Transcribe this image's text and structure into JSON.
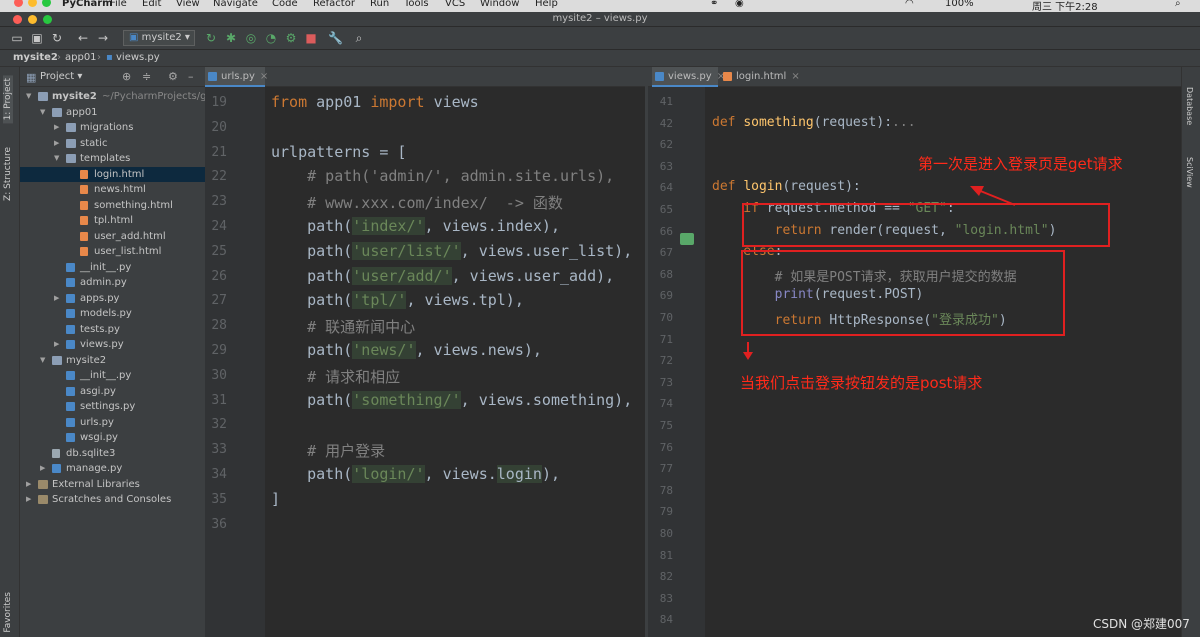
{
  "menubar": {
    "app": "PyCharm",
    "items": [
      "File",
      "Edit",
      "View",
      "Navigate",
      "Code",
      "Refactor",
      "Run",
      "Tools",
      "VCS",
      "Window",
      "Help"
    ],
    "title": "mysite2 – views.py",
    "battery": "100%",
    "clock": "周三 下午2:28"
  },
  "toolbar": {
    "run_config": "mysite2"
  },
  "breadcrumb": {
    "items": [
      "mysite2",
      "app01",
      "views.py"
    ]
  },
  "left_toolwindows": [
    "1: Project",
    "Z: Structure",
    "Favorites"
  ],
  "right_toolwindows": [
    "Database",
    "SciView"
  ],
  "project": {
    "title": "Project",
    "tree": [
      {
        "label": "mysite2",
        "suffix": "~/PycharmProjects/gx",
        "depth": 0,
        "type": "folder",
        "expanded": true
      },
      {
        "label": "app01",
        "depth": 1,
        "type": "folder",
        "expanded": true
      },
      {
        "label": "migrations",
        "depth": 2,
        "type": "folder",
        "expanded": false
      },
      {
        "label": "static",
        "depth": 2,
        "type": "folder",
        "expanded": false
      },
      {
        "label": "templates",
        "depth": 2,
        "type": "folder",
        "expanded": true
      },
      {
        "label": "login.html",
        "depth": 3,
        "type": "html",
        "selected": true
      },
      {
        "label": "news.html",
        "depth": 3,
        "type": "html"
      },
      {
        "label": "something.html",
        "depth": 3,
        "type": "html"
      },
      {
        "label": "tpl.html",
        "depth": 3,
        "type": "html"
      },
      {
        "label": "user_add.html",
        "depth": 3,
        "type": "html"
      },
      {
        "label": "user_list.html",
        "depth": 3,
        "type": "html"
      },
      {
        "label": "__init__.py",
        "depth": 2,
        "type": "py"
      },
      {
        "label": "admin.py",
        "depth": 2,
        "type": "py"
      },
      {
        "label": "apps.py",
        "depth": 2,
        "type": "py",
        "collapsible": true
      },
      {
        "label": "models.py",
        "depth": 2,
        "type": "py"
      },
      {
        "label": "tests.py",
        "depth": 2,
        "type": "py"
      },
      {
        "label": "views.py",
        "depth": 2,
        "type": "py",
        "collapsible": true
      },
      {
        "label": "mysite2",
        "depth": 1,
        "type": "folder",
        "expanded": true
      },
      {
        "label": "__init__.py",
        "depth": 2,
        "type": "py"
      },
      {
        "label": "asgi.py",
        "depth": 2,
        "type": "py"
      },
      {
        "label": "settings.py",
        "depth": 2,
        "type": "py"
      },
      {
        "label": "urls.py",
        "depth": 2,
        "type": "py"
      },
      {
        "label": "wsgi.py",
        "depth": 2,
        "type": "py"
      },
      {
        "label": "db.sqlite3",
        "depth": 1,
        "type": "db"
      },
      {
        "label": "manage.py",
        "depth": 1,
        "type": "py",
        "collapsible": true
      },
      {
        "label": "External Libraries",
        "depth": 0,
        "type": "lib",
        "expanded": false
      },
      {
        "label": "Scratches and Consoles",
        "depth": 0,
        "type": "lib",
        "expanded": false
      }
    ]
  },
  "left_editor": {
    "tabs": [
      {
        "label": "urls.py",
        "active": true
      }
    ],
    "line_numbers": [
      "19",
      "20",
      "21",
      "22",
      "23",
      "24",
      "25",
      "26",
      "27",
      "28",
      "29",
      "30",
      "31",
      "32",
      "33",
      "34",
      "35",
      "36"
    ],
    "lines": [
      [
        [
          "kw",
          "from "
        ],
        [
          "t",
          "app01 "
        ],
        [
          "kw",
          "import "
        ],
        [
          "t",
          "views"
        ]
      ],
      [],
      [
        [
          "t",
          "urlpatterns = ["
        ]
      ],
      [
        [
          "cm",
          "    # path('admin/', admin.site.urls),"
        ]
      ],
      [
        [
          "cm",
          "    # www.xxx.com/index/  -> 函数"
        ]
      ],
      [
        [
          "t",
          "    path("
        ],
        [
          "strh",
          "'index/'"
        ],
        [
          "t",
          ", views.index),"
        ]
      ],
      [
        [
          "t",
          "    path("
        ],
        [
          "strh",
          "'user/list/'"
        ],
        [
          "t",
          ", views.user_list),"
        ]
      ],
      [
        [
          "t",
          "    path("
        ],
        [
          "strh",
          "'user/add/'"
        ],
        [
          "t",
          ", views.user_add),"
        ]
      ],
      [
        [
          "t",
          "    path("
        ],
        [
          "strh",
          "'tpl/'"
        ],
        [
          "t",
          ", views.tpl),"
        ]
      ],
      [
        [
          "cm",
          "    # 联通新闻中心"
        ]
      ],
      [
        [
          "t",
          "    path("
        ],
        [
          "strh",
          "'news/'"
        ],
        [
          "t",
          ", views.news),"
        ]
      ],
      [
        [
          "cm",
          "    # 请求和相应"
        ]
      ],
      [
        [
          "t",
          "    path("
        ],
        [
          "strh",
          "'something/'"
        ],
        [
          "t",
          ", views.something),"
        ]
      ],
      [],
      [
        [
          "cm",
          "    # 用户登录"
        ]
      ],
      [
        [
          "t",
          "    path("
        ],
        [
          "strh",
          "'login/'"
        ],
        [
          "t",
          ", views."
        ],
        [
          "th",
          "login"
        ],
        [
          "t",
          "),"
        ]
      ],
      [
        [
          "t",
          "]"
        ]
      ],
      []
    ]
  },
  "right_editor": {
    "tabs": [
      {
        "label": "views.py",
        "active": true
      },
      {
        "label": "login.html",
        "active": false
      }
    ],
    "line_numbers": [
      "41",
      "42",
      "62",
      "63",
      "64",
      "65",
      "66",
      "67",
      "68",
      "69",
      "70",
      "71",
      "72",
      "73",
      "74",
      "75",
      "76",
      "77",
      "78",
      "79",
      "80",
      "81",
      "82",
      "83",
      "84"
    ],
    "lines": [
      [],
      [
        [
          "kw",
          "def "
        ],
        [
          "fn",
          "something"
        ],
        [
          "t",
          "(request):"
        ],
        [
          "cm",
          "..."
        ]
      ],
      [],
      [],
      [
        [
          "kw",
          "def "
        ],
        [
          "fn",
          "login"
        ],
        [
          "t",
          "(request):"
        ]
      ],
      [
        [
          "kw",
          "    if "
        ],
        [
          "t",
          "request.method == "
        ],
        [
          "str",
          "\"GET\""
        ],
        [
          "t",
          ":"
        ]
      ],
      [
        [
          "kw",
          "        return "
        ],
        [
          "t",
          "render(request, "
        ],
        [
          "str",
          "\"login.html\""
        ],
        [
          "t",
          ")"
        ]
      ],
      [
        [
          "kw",
          "    else"
        ],
        [
          "t",
          ":"
        ]
      ],
      [
        [
          "cm",
          "        # 如果是POST请求，获取用户提交的数据"
        ]
      ],
      [
        [
          "bi",
          "        print"
        ],
        [
          "t",
          "(request.POST)"
        ]
      ],
      [
        [
          "kw",
          "        return "
        ],
        [
          "t",
          "HttpResponse("
        ],
        [
          "str",
          "\"登录成功\""
        ],
        [
          "t",
          ")"
        ]
      ],
      [],
      [],
      [],
      [],
      [],
      [],
      [],
      [],
      [],
      [],
      [],
      [],
      [],
      []
    ]
  },
  "annotations": {
    "get_note": "第一次是进入登录页是get请求",
    "post_note": "当我们点击登录按钮发的是post请求"
  },
  "watermark": "CSDN @郑建007",
  "colors": {
    "annotation_red": "#ff2a1a",
    "editor_bg": "#2b2b2b",
    "keyword": "#cc7832",
    "string": "#6a8759"
  }
}
